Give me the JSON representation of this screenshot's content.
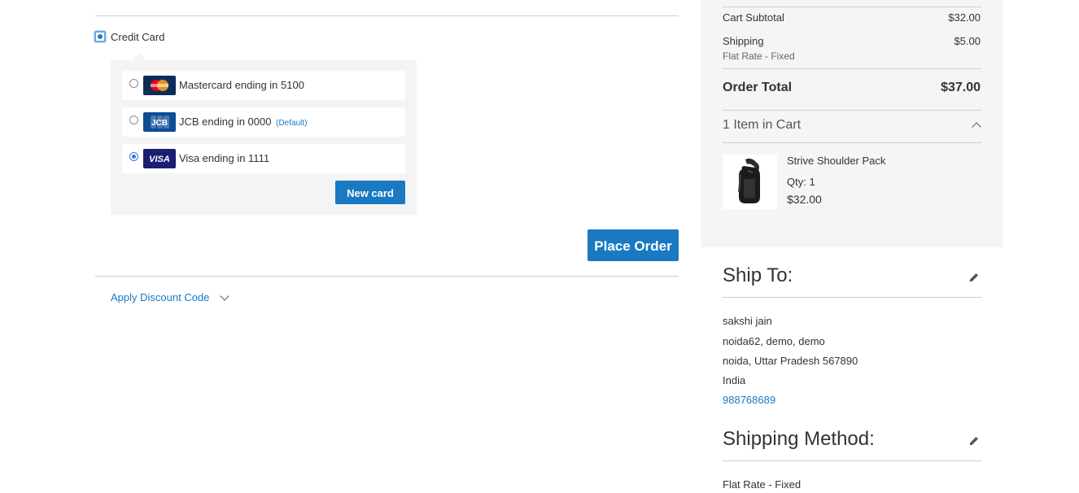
{
  "payment": {
    "method_label": "Credit Card",
    "cards": [
      {
        "brand": "mastercard-logo",
        "label": "Mastercard ending in 5100",
        "default_tag": "",
        "selected": false
      },
      {
        "brand": "jcb-logo",
        "label": "JCB ending in 0000",
        "default_tag": "(Default)",
        "selected": false
      },
      {
        "brand": "visa-logo",
        "label": "Visa ending in 1111",
        "default_tag": "",
        "selected": true
      }
    ],
    "new_card_label": "New card",
    "place_order_label": "Place Order",
    "discount_label": "Apply Discount Code"
  },
  "summary": {
    "cart_subtotal_label": "Cart Subtotal",
    "cart_subtotal_value": "$32.00",
    "shipping_label": "Shipping",
    "shipping_value": "$5.00",
    "shipping_method": "Flat Rate - Fixed",
    "order_total_label": "Order Total",
    "order_total_value": "$37.00",
    "items_title": "1 Item in Cart",
    "product": {
      "name": "Strive Shoulder Pack",
      "qty": "Qty: 1",
      "price": "$32.00"
    }
  },
  "ship_to": {
    "title": "Ship To:",
    "name": "sakshi jain",
    "street": "noida62, demo, demo",
    "city_line": "noida, Uttar Pradesh 567890",
    "country": "India",
    "phone": "988768689"
  },
  "shipping_method": {
    "title": "Shipping Method:",
    "value": "Flat Rate - Fixed"
  },
  "colors": {
    "primary": "#1979c3",
    "summary_bg": "#f5f5f5",
    "panel_bg": "#f4f4f4",
    "visa_blue": "#1a1f71"
  }
}
